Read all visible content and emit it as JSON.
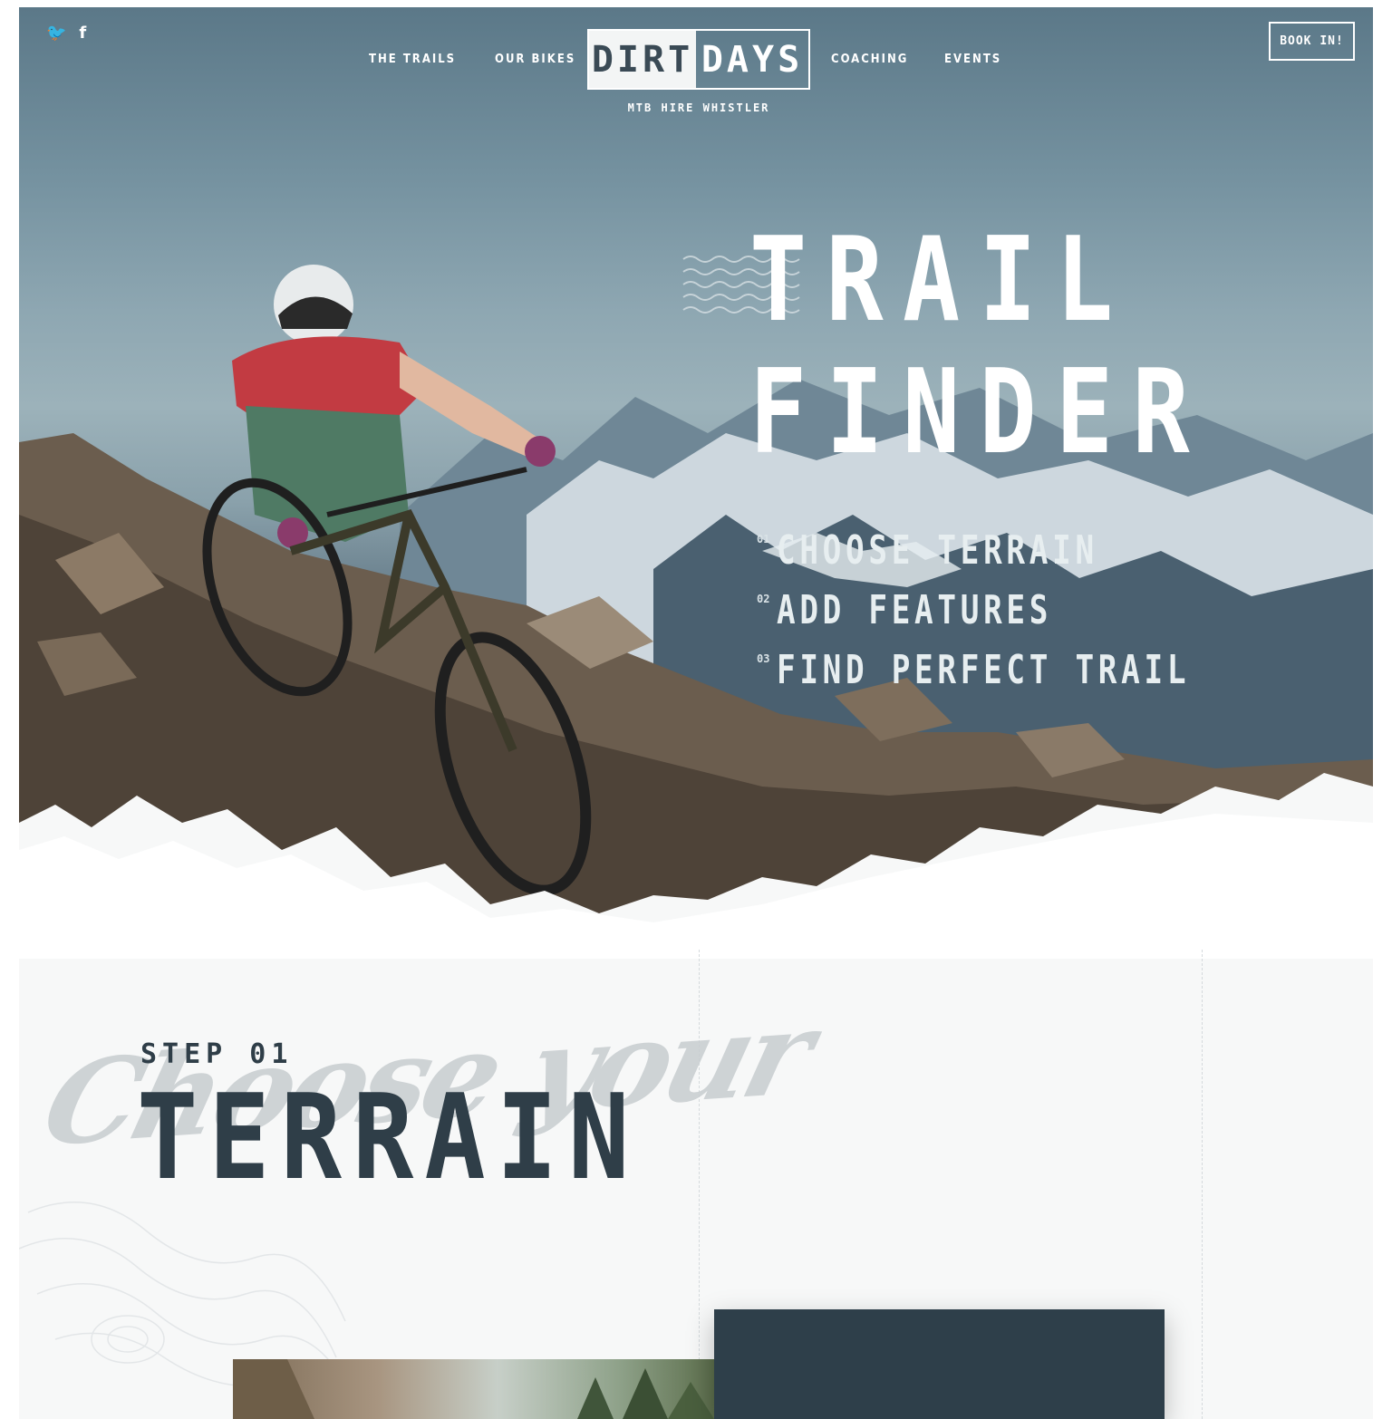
{
  "social": {
    "twitter_icon": "twitter-icon",
    "facebook_icon": "facebook-icon",
    "twitter_glyph": "🐦",
    "facebook_glyph": "f"
  },
  "nav": {
    "left": [
      "THE TRAILS",
      "OUR BIKES"
    ],
    "right": [
      "COACHING",
      "EVENTS"
    ],
    "logo_left": "DIRT",
    "logo_right": "DAYS",
    "tagline": "MTB HIRE WHISTLER",
    "cta": "BOOK IN!"
  },
  "hero": {
    "title_line1": "TRAIL",
    "title_line2": "FINDER",
    "steps": [
      {
        "num": "01",
        "text": "CHOOSE TERRAIN"
      },
      {
        "num": "02",
        "text": "ADD FEATURES"
      },
      {
        "num": "03",
        "text": "FIND PERFECT TRAIL"
      }
    ]
  },
  "section": {
    "script_text": "Choose your",
    "step_label": "STEP 01",
    "heading": "TERRAIN"
  },
  "colors": {
    "dark_slate": "#2f3e48",
    "card": "#2e3f4a",
    "white": "#ffffff"
  }
}
